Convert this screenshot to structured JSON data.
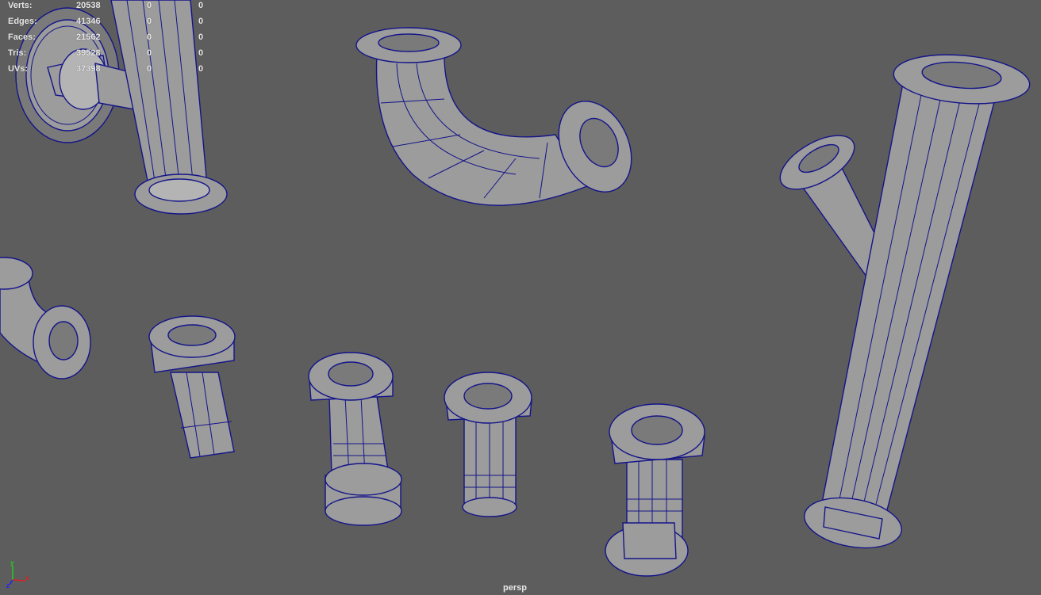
{
  "hud": {
    "rows": [
      {
        "label": "Verts:",
        "total": "20538",
        "selected": "0",
        "component": "0"
      },
      {
        "label": "Edges:",
        "total": "41346",
        "selected": "0",
        "component": "0"
      },
      {
        "label": "Faces:",
        "total": "21562",
        "selected": "0",
        "component": "0"
      },
      {
        "label": "Tris:",
        "total": "39528",
        "selected": "0",
        "component": "0"
      },
      {
        "label": "UVs:",
        "total": "37398",
        "selected": "0",
        "component": "0"
      }
    ]
  },
  "camera_label": "persp",
  "axis": {
    "x": "x",
    "y": "y",
    "z": "z",
    "x_color": "#e02020",
    "y_color": "#20d020",
    "z_color": "#2020ff"
  },
  "colors": {
    "background": "#5d5d5d",
    "mesh": "#9c9c9c",
    "wireframe": "#14148a"
  }
}
